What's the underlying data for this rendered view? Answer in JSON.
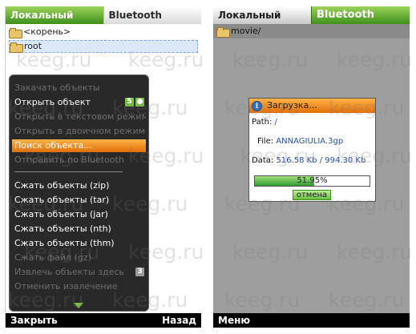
{
  "left_screen": {
    "tabs": [
      "Локальный",
      "Bluetooth"
    ],
    "files": [
      {
        "name": "<корень>"
      },
      {
        "name": "root"
      }
    ],
    "menu": {
      "items": [
        {
          "label": "Закачать объекты",
          "state": "disabled"
        },
        {
          "label": "Открыть объект",
          "state": "enabled",
          "badge": "5"
        },
        {
          "label": "Открыть в текстовом режиме",
          "state": "disabled"
        },
        {
          "label": "Открыть в двоичном режиме",
          "state": "disabled"
        },
        {
          "label": "Поиск объекта...",
          "state": "highlight"
        },
        {
          "label": "Отправить по Bluetooth",
          "state": "disabled"
        },
        {
          "label": "Сжать объекты (zip)",
          "state": "enabled"
        },
        {
          "label": "Сжать объекты (tar)",
          "state": "enabled"
        },
        {
          "label": "Сжать объекты (jar)",
          "state": "enabled"
        },
        {
          "label": "Сжать объекты (nth)",
          "state": "enabled"
        },
        {
          "label": "Сжать объекты (thm)",
          "state": "enabled"
        },
        {
          "label": "Сжать файл (gz)",
          "state": "disabled"
        },
        {
          "label": "Извлечь объекты здесь",
          "state": "disabled",
          "badge": "3"
        },
        {
          "label": "Отменить извлечение",
          "state": "disabled"
        }
      ]
    },
    "softkeys": {
      "left": "Закрыть",
      "right": "Назад"
    }
  },
  "right_screen": {
    "tabs": [
      "Локальный",
      "Bluetooth"
    ],
    "path": "movie/",
    "dialog": {
      "title": "Загрузка...",
      "path_label": "Path:",
      "path_value": "/",
      "file_label": "File:",
      "file_value": "ANNAGIULIA.3gp",
      "data_label": "Data:",
      "data_value": "516.58 Kb / 994.30 Kb",
      "progress_percent": 51.95,
      "progress_text": "51.95%",
      "cancel_label": "отмена"
    },
    "softkeys": {
      "left": "Меню"
    }
  },
  "watermark": "keeg.ru",
  "colors": {
    "accent_green": "#7bc043",
    "highlight_orange": "#f28c1a",
    "softbar_black": "#000000",
    "link_blue": "#2a4fa8"
  }
}
